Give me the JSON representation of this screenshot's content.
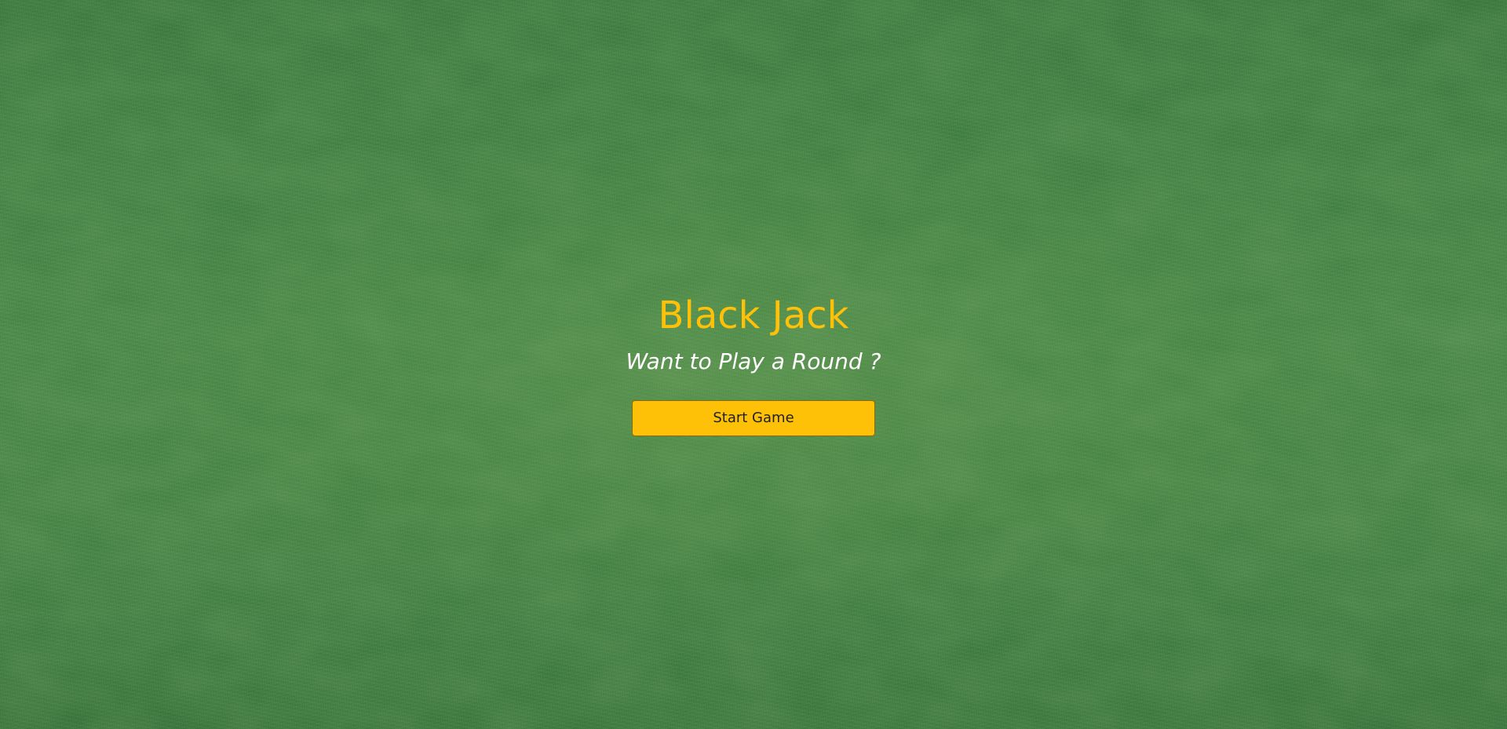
{
  "game": {
    "title": "Black Jack",
    "subtitle": "Want to Play a Round ?",
    "start_button_label": "Start Game"
  },
  "colors": {
    "accent": "#ffc107",
    "background": "#3f7f3a",
    "subtitle_text": "#ffffff",
    "button_text": "#212121"
  }
}
